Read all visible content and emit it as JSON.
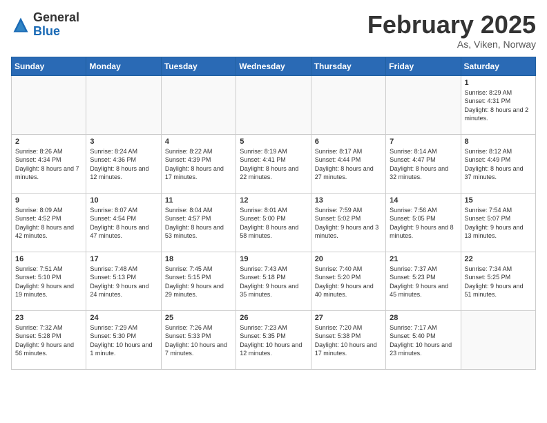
{
  "header": {
    "logo_general": "General",
    "logo_blue": "Blue",
    "title": "February 2025",
    "subtitle": "As, Viken, Norway"
  },
  "weekdays": [
    "Sunday",
    "Monday",
    "Tuesday",
    "Wednesday",
    "Thursday",
    "Friday",
    "Saturday"
  ],
  "weeks": [
    [
      {
        "day": "",
        "info": ""
      },
      {
        "day": "",
        "info": ""
      },
      {
        "day": "",
        "info": ""
      },
      {
        "day": "",
        "info": ""
      },
      {
        "day": "",
        "info": ""
      },
      {
        "day": "",
        "info": ""
      },
      {
        "day": "1",
        "info": "Sunrise: 8:29 AM\nSunset: 4:31 PM\nDaylight: 8 hours and 2 minutes."
      }
    ],
    [
      {
        "day": "2",
        "info": "Sunrise: 8:26 AM\nSunset: 4:34 PM\nDaylight: 8 hours and 7 minutes."
      },
      {
        "day": "3",
        "info": "Sunrise: 8:24 AM\nSunset: 4:36 PM\nDaylight: 8 hours and 12 minutes."
      },
      {
        "day": "4",
        "info": "Sunrise: 8:22 AM\nSunset: 4:39 PM\nDaylight: 8 hours and 17 minutes."
      },
      {
        "day": "5",
        "info": "Sunrise: 8:19 AM\nSunset: 4:41 PM\nDaylight: 8 hours and 22 minutes."
      },
      {
        "day": "6",
        "info": "Sunrise: 8:17 AM\nSunset: 4:44 PM\nDaylight: 8 hours and 27 minutes."
      },
      {
        "day": "7",
        "info": "Sunrise: 8:14 AM\nSunset: 4:47 PM\nDaylight: 8 hours and 32 minutes."
      },
      {
        "day": "8",
        "info": "Sunrise: 8:12 AM\nSunset: 4:49 PM\nDaylight: 8 hours and 37 minutes."
      }
    ],
    [
      {
        "day": "9",
        "info": "Sunrise: 8:09 AM\nSunset: 4:52 PM\nDaylight: 8 hours and 42 minutes."
      },
      {
        "day": "10",
        "info": "Sunrise: 8:07 AM\nSunset: 4:54 PM\nDaylight: 8 hours and 47 minutes."
      },
      {
        "day": "11",
        "info": "Sunrise: 8:04 AM\nSunset: 4:57 PM\nDaylight: 8 hours and 53 minutes."
      },
      {
        "day": "12",
        "info": "Sunrise: 8:01 AM\nSunset: 5:00 PM\nDaylight: 8 hours and 58 minutes."
      },
      {
        "day": "13",
        "info": "Sunrise: 7:59 AM\nSunset: 5:02 PM\nDaylight: 9 hours and 3 minutes."
      },
      {
        "day": "14",
        "info": "Sunrise: 7:56 AM\nSunset: 5:05 PM\nDaylight: 9 hours and 8 minutes."
      },
      {
        "day": "15",
        "info": "Sunrise: 7:54 AM\nSunset: 5:07 PM\nDaylight: 9 hours and 13 minutes."
      }
    ],
    [
      {
        "day": "16",
        "info": "Sunrise: 7:51 AM\nSunset: 5:10 PM\nDaylight: 9 hours and 19 minutes."
      },
      {
        "day": "17",
        "info": "Sunrise: 7:48 AM\nSunset: 5:13 PM\nDaylight: 9 hours and 24 minutes."
      },
      {
        "day": "18",
        "info": "Sunrise: 7:45 AM\nSunset: 5:15 PM\nDaylight: 9 hours and 29 minutes."
      },
      {
        "day": "19",
        "info": "Sunrise: 7:43 AM\nSunset: 5:18 PM\nDaylight: 9 hours and 35 minutes."
      },
      {
        "day": "20",
        "info": "Sunrise: 7:40 AM\nSunset: 5:20 PM\nDaylight: 9 hours and 40 minutes."
      },
      {
        "day": "21",
        "info": "Sunrise: 7:37 AM\nSunset: 5:23 PM\nDaylight: 9 hours and 45 minutes."
      },
      {
        "day": "22",
        "info": "Sunrise: 7:34 AM\nSunset: 5:25 PM\nDaylight: 9 hours and 51 minutes."
      }
    ],
    [
      {
        "day": "23",
        "info": "Sunrise: 7:32 AM\nSunset: 5:28 PM\nDaylight: 9 hours and 56 minutes."
      },
      {
        "day": "24",
        "info": "Sunrise: 7:29 AM\nSunset: 5:30 PM\nDaylight: 10 hours and 1 minute."
      },
      {
        "day": "25",
        "info": "Sunrise: 7:26 AM\nSunset: 5:33 PM\nDaylight: 10 hours and 7 minutes."
      },
      {
        "day": "26",
        "info": "Sunrise: 7:23 AM\nSunset: 5:35 PM\nDaylight: 10 hours and 12 minutes."
      },
      {
        "day": "27",
        "info": "Sunrise: 7:20 AM\nSunset: 5:38 PM\nDaylight: 10 hours and 17 minutes."
      },
      {
        "day": "28",
        "info": "Sunrise: 7:17 AM\nSunset: 5:40 PM\nDaylight: 10 hours and 23 minutes."
      },
      {
        "day": "",
        "info": ""
      }
    ]
  ]
}
